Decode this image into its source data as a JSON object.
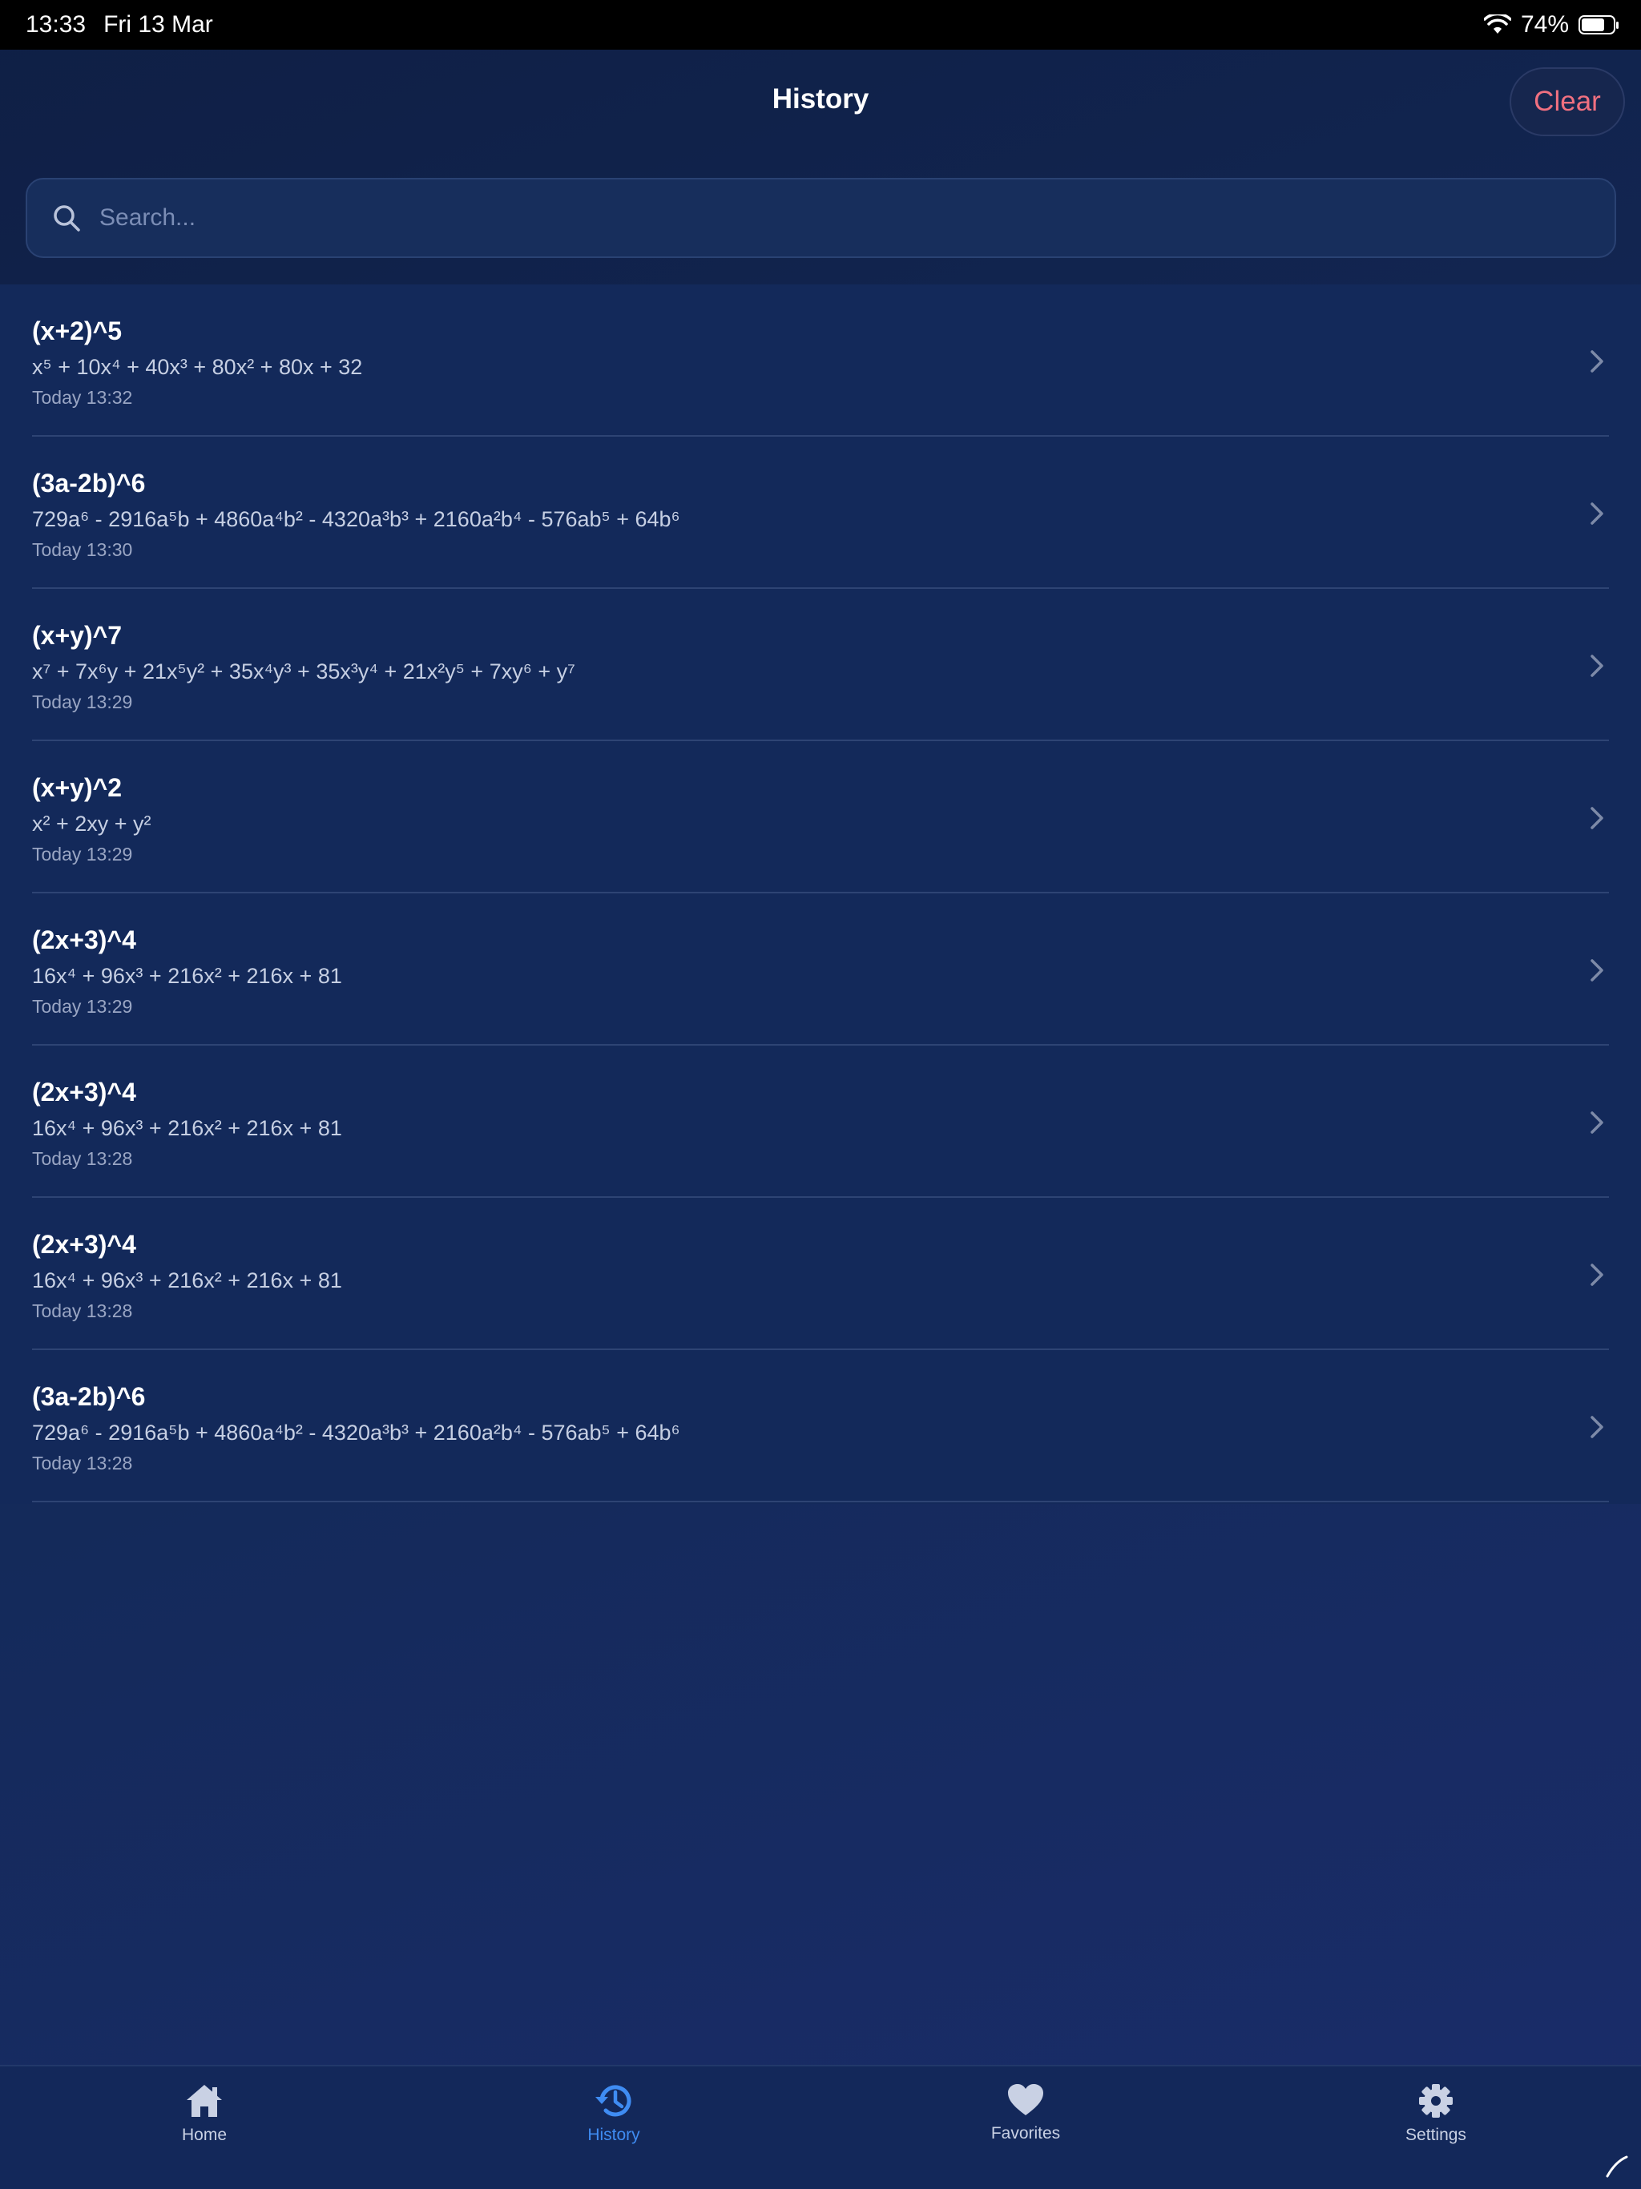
{
  "status_bar": {
    "time": "13:33",
    "date": "Fri 13 Mar",
    "battery": "74%",
    "battery_level": 0.74,
    "wifi_icon": "wifi-icon"
  },
  "header": {
    "title": "History",
    "clear_label": "Clear"
  },
  "search": {
    "placeholder": "Search...",
    "value": ""
  },
  "history": [
    {
      "expr": "(x+2)^5",
      "result": "x⁵ + 10x⁴ + 40x³ + 80x² + 80x + 32",
      "time": "Today 13:32"
    },
    {
      "expr": "(3a-2b)^6",
      "result": "729a⁶ - 2916a⁵b + 4860a⁴b² - 4320a³b³ + 2160a²b⁴ - 576ab⁵ + 64b⁶",
      "time": "Today 13:30"
    },
    {
      "expr": "(x+y)^7",
      "result": "x⁷ + 7x⁶y + 21x⁵y² + 35x⁴y³ + 35x³y⁴ + 21x²y⁵ + 7xy⁶ + y⁷",
      "time": "Today 13:29"
    },
    {
      "expr": "(x+y)^2",
      "result": "x² + 2xy + y²",
      "time": "Today 13:29"
    },
    {
      "expr": "(2x+3)^4",
      "result": "16x⁴ + 96x³ + 216x² + 216x + 81",
      "time": "Today 13:29"
    },
    {
      "expr": "(2x+3)^4",
      "result": "16x⁴ + 96x³ + 216x² + 216x + 81",
      "time": "Today 13:28"
    },
    {
      "expr": "(2x+3)^4",
      "result": "16x⁴ + 96x³ + 216x² + 216x + 81",
      "time": "Today 13:28"
    },
    {
      "expr": "(3a-2b)^6",
      "result": "729a⁶ - 2916a⁵b + 4860a⁴b² - 4320a³b³ + 2160a²b⁴ - 576ab⁵ + 64b⁶",
      "time": "Today 13:28"
    }
  ],
  "tabs": [
    {
      "label": "Home",
      "icon": "home-icon",
      "active": false
    },
    {
      "label": "History",
      "icon": "history-icon",
      "active": true
    },
    {
      "label": "Favorites",
      "icon": "heart-icon",
      "active": false
    },
    {
      "label": "Settings",
      "icon": "gear-icon",
      "active": false
    }
  ],
  "colors": {
    "accent": "#3f8cf2",
    "clear_text": "#f07080",
    "background": "#13295a",
    "status_bar": "#000000"
  }
}
